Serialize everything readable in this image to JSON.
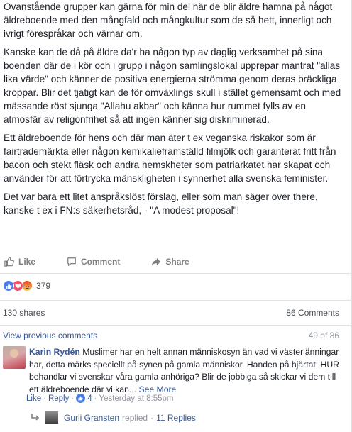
{
  "post": {
    "paragraphs": [
      "Ovanstående grupper kan gärna för min del när de blir äldre hamna på något äldreboende med den mångfald och mångkultur som de så hett, innerligt och ivrigt förespråkar och värnar om.",
      "Kanske kan de då på äldre da'r ha någon typ av daglig verksamhet på sina boenden där de i kör och i grupp i någon samlingslokal upprepar mantrat \"allas lika värde\" och känner de positiva energierna strömma genom deras bräckliga kroppar. Blir det tjatigt kan de för omväxlings skull i stället gemensamt och med mässande röst sjunga \"Allahu akbar\" och känna hur rummet fylls av en atmosfär av religonfrihet så att ingen känner sig diskriminerad.",
      "Ett äldreboende för hens och där man äter t ex veganska riskakor som är fairtrademärkta eller någon kemikalieframställd filmjölk och garanterat fritt från bacon och stekt fläsk och andra hemskheter som patriarkatet har skapat och använder för att förtrycka mänskligheten i synnerhet alla svenska feminister.",
      "Det var bara ett litet anspråkslöst förslag, eller som man säger over there, kanske t ex i FN:s säkerhetsråd, - \"A modest proposal\"!"
    ]
  },
  "actions": {
    "like": "Like",
    "comment": "Comment",
    "share": "Share"
  },
  "reactions": {
    "count": "379",
    "icons": [
      "like-reaction",
      "love-reaction",
      "angry-reaction"
    ],
    "colors": {
      "like": "#4a7dea",
      "love": "#f25268",
      "angry": "#f26f24"
    }
  },
  "stats": {
    "shares": "130 shares",
    "comments": "86 Comments"
  },
  "comments_nav": {
    "view_previous": "View previous comments",
    "position": "49 of 86"
  },
  "comment": {
    "author": "Karin Rydén",
    "text": "Muslimer har en helt annan människosyn än vad vi västerlänningar har, detta märks speciellt på synen på gamla människor. Handen på hjärtat: HUR behandlar vi svenskar våra gamla anhöriga? Blir de jobbiga så skickar vi dem till ett äldreboende där vi kan...",
    "see_more": "See More",
    "like": "Like",
    "reply": "Reply",
    "like_count": "4",
    "time": "Yesterday at 8:55pm"
  },
  "reply_summary": {
    "name": "Gurli Gransten",
    "verb": "replied",
    "count": "11 Replies"
  },
  "colors": {
    "link": "#365899",
    "muted": "#90949c",
    "text": "#1d2129"
  }
}
